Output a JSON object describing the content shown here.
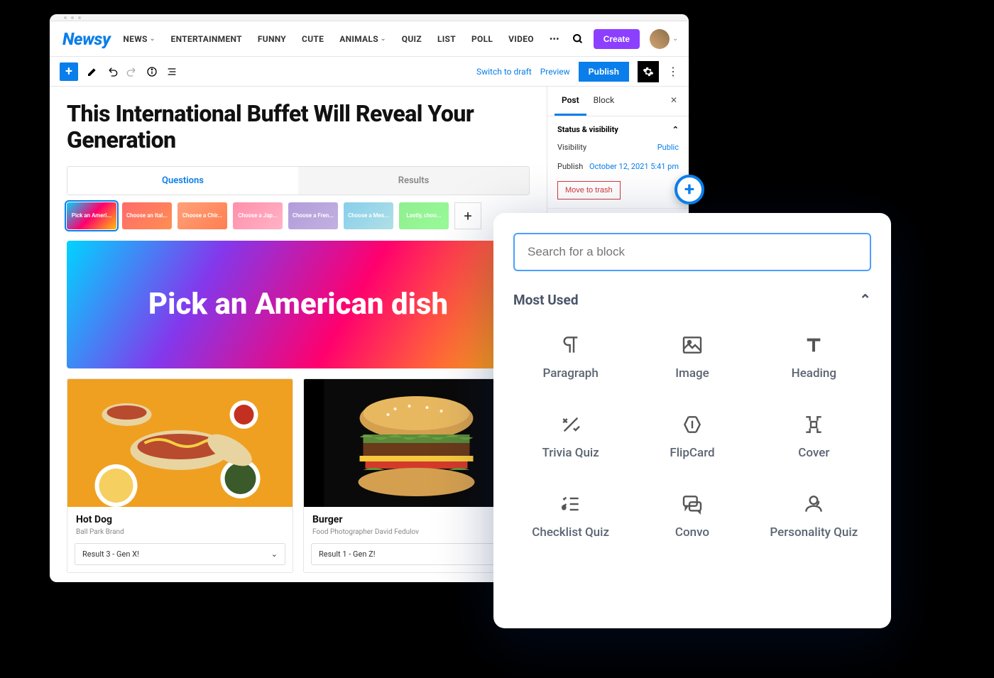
{
  "logo": "Newsy",
  "nav": {
    "items": [
      "NEWS",
      "ENTERTAINMENT",
      "FUNNY",
      "CUTE",
      "ANIMALS",
      "QUIZ",
      "LIST",
      "POLL",
      "VIDEO"
    ],
    "has_dropdown": [
      true,
      false,
      false,
      false,
      true,
      false,
      false,
      false,
      false
    ]
  },
  "create_button": "Create",
  "toolbar": {
    "switch_draft": "Switch to draft",
    "preview": "Preview",
    "publish": "Publish"
  },
  "post_title": "This International Buffet Will Reveal Your Generation",
  "editor_tabs": {
    "questions": "Questions",
    "results": "Results"
  },
  "question_thumbs": [
    "Pick an Ameri...",
    "Choose an Ital...",
    "Choose a Chir...",
    "Choose a Jap...",
    "Choose a Fren...",
    "Choose a Mex...",
    "Lastly, choo..."
  ],
  "question_hero": "Pick an American dish",
  "answers": [
    {
      "title": "Hot Dog",
      "credit": "Ball Park Brand",
      "result": "Result 3 - Gen X!"
    },
    {
      "title": "Burger",
      "credit": "Food Photographer David Fedulov",
      "result": "Result 1 - Gen Z!"
    }
  ],
  "sidebar": {
    "tabs": {
      "post": "Post",
      "block": "Block"
    },
    "section_status": "Status & visibility",
    "visibility_label": "Visibility",
    "visibility_value": "Public",
    "publish_label": "Publish",
    "publish_value": "October 12, 2021 5:41 pm",
    "trash": "Move to trash"
  },
  "inserter": {
    "search_placeholder": "Search for a block",
    "section": "Most Used",
    "blocks": [
      {
        "icon": "paragraph",
        "label": "Paragraph"
      },
      {
        "icon": "image",
        "label": "Image"
      },
      {
        "icon": "heading",
        "label": "Heading"
      },
      {
        "icon": "trivia",
        "label": "Trivia Quiz"
      },
      {
        "icon": "flipcard",
        "label": "FlipCard"
      },
      {
        "icon": "cover",
        "label": "Cover"
      },
      {
        "icon": "checklist",
        "label": "Checklist Quiz"
      },
      {
        "icon": "convo",
        "label": "Convo"
      },
      {
        "icon": "personality",
        "label": "Personality Quiz"
      }
    ]
  }
}
